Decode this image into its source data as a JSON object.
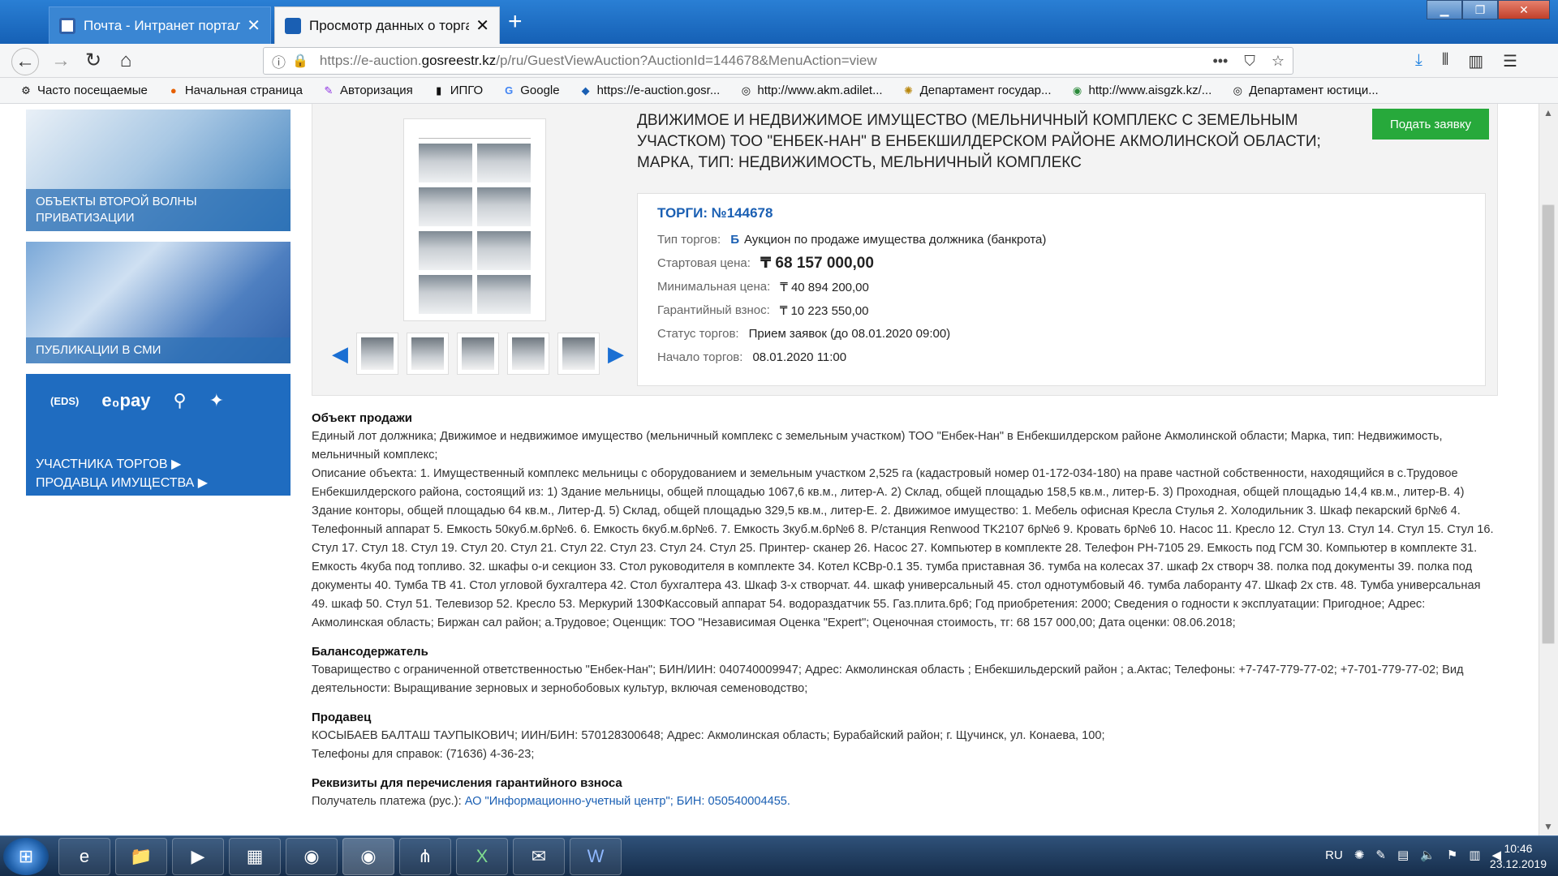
{
  "browser": {
    "tabs": [
      {
        "title": "Почта - Интранет портал гос",
        "close": "✕"
      },
      {
        "title": "Просмотр данных о торгах",
        "close": "✕"
      }
    ],
    "new_tab": "+",
    "window_buttons": {
      "minimize": "▁",
      "maximize": "❐",
      "close": "✕"
    },
    "url_prefix": "https://e-auction.",
    "url_domain": "gosreestr.kz",
    "url_suffix": "/p/ru/GuestViewAuction?AuctionId=144678&MenuAction=view",
    "bookmarks": [
      {
        "label": "Часто посещаемые",
        "icon": "⚙"
      },
      {
        "label": "Начальная страница",
        "icon": "●"
      },
      {
        "label": "Авторизация",
        "icon": "✎"
      },
      {
        "label": "ИПГО",
        "icon": "▮"
      },
      {
        "label": "Google",
        "icon": "G"
      },
      {
        "label": "https://e-auction.gosr...",
        "icon": "◆"
      },
      {
        "label": "http://www.akm.adilet...",
        "icon": "◎"
      },
      {
        "label": "Департамент государ...",
        "icon": "✺"
      },
      {
        "label": "http://www.aisgzk.kz/...",
        "icon": "◉"
      },
      {
        "label": "Департамент юстици...",
        "icon": "◎"
      }
    ]
  },
  "sidebar": {
    "card1": "Объекты второй волны приватизации",
    "card2": "Публикации в СМИ",
    "card3_icons": [
      "(EDS)",
      "e₀pay",
      "⚲",
      "✦"
    ],
    "card3_link1": "Участника торгов ▶",
    "card3_link2": "Продавца имущества ▶"
  },
  "lot": {
    "title": "Движимое и недвижимое имущество (мельничный комплекс с земельным участком) ТОО \"ЕНБЕК-НАН\" в Енбекшилдерском районе Акмолинской области; Марка, тип: Недвижимость, мельничный комплекс",
    "apply_button": "Подать заявку",
    "torgi": "ТОРГИ: №144678",
    "type_label": "Тип торгов:",
    "type_badge": "Б",
    "type_value": "Аукцион по продаже имущества должника (банкрота)",
    "start_price_label": "Стартовая цена:",
    "start_price": "₸ 68 157 000,00",
    "min_price_label": "Минимальная цена:",
    "min_price": "₸ 40 894 200,00",
    "guarantee_label": "Гарантийный взнос:",
    "guarantee": "₸ 10 223 550,00",
    "status_label": "Статус торгов:",
    "status": "Прием заявок (до 08.01.2020 09:00)",
    "start_label": "Начало торгов:",
    "start": "08.01.2020 11:00"
  },
  "description": {
    "sale_heading": "Объект продажи",
    "sale_text1": "Единый лот должника; Движимое и недвижимое имущество (мельничный комплекс с земельным участком) ТОО \"Енбек-Нан\" в Енбекшилдерском районе Акмолинской области; Марка, тип: Недвижимость, мельничный комплекс;",
    "sale_text2": "Описание объекта: 1. Имущественный комплекс мельницы с оборудованием и земельным участком 2,525 га (кадастровый номер 01-172-034-180) на праве частной собственности, находящийся в с.Трудовое Енбекшилдерского района, состоящий из: 1) Здание мельницы, общей площадью 1067,6 кв.м., литер-А. 2) Склад, общей площадью 158,5 кв.м., литер-Б. 3) Проходная, общей площадью 14,4 кв.м., литер-В. 4) Здание конторы, общей площадью 64 кв.м., Литер-Д. 5) Склад, общей площадью 329,5 кв.м., литер-Е. 2. Движимое имущество: 1. Мебель офисная Кресла Стулья 2. Холодильник 3. Шкаф пекарский 6р№6 4. Телефонный аппарат 5. Емкость 50куб.м.6р№6. 6. Емкость 6куб.м.6р№6. 7. Емкость 3куб.м.6р№6 8. Р/станция Renwood TK2107 6р№6 9. Кровать 6р№6 10. Насос 11. Кресло 12. Стул 13. Стул 14. Стул 15. Стул 16. Стул 17. Стул 18. Стул 19. Стул 20. Стул 21. Стул 22. Стул 23. Стул 24. Стул 25. Принтер- сканер 26. Насос 27. Компьютер в комплекте 28. Телефон PH-7105 29. Емкость под ГСМ 30. Компьютер в комплекте 31. Емкость 4куба под топливо. 32. шкафы о-и секцион 33. Стол руководителя в комплекте 34. Котел КСВр-0.1 35. тумба приставная 36. тумба на колесах 37. шкаф 2х створч 38. полка под документы 39. полка под документы 40. Тумба ТВ 41. Стол угловой бухгалтера 42. Стол бухгалтера 43. Шкаф 3-х створчат. 44. шкаф универсальный 45. стол однотумбовый 46. тумба лаборанту 47. Шкаф 2х ств. 48. Тумба универсальная 49. шкаф 50. Стул 51. Телевизор 52. Кресло 53. Меркурий 130ФКассовый аппарат 54. водораздатчик 55. Газ.плита.6р6; Год приобретения: 2000; Сведения о годности к эксплуатации: Пригодное; Адрес: Акмолинская область; Биржан сал район; а.Трудовое; Оценщик: ТОО \"Независимая Оценка \"Expert\"; Оценочная стоимость, тг: 68 157 000,00; Дата оценки: 08.06.2018;",
    "holder_heading": "Балансодержатель",
    "holder_text": "Товарищество с ограниченной ответственностью \"Енбек-Нан\"; БИН/ИИН: 040740009947; Адрес: Акмолинская область ; Енбекшильдерский район ; а.Актас; Телефоны: +7-747-779-77-02; +7-701-779-77-02; Вид деятельности: Выращивание зерновых и зернобобовых культур, включая семеноводство;",
    "seller_heading": "Продавец",
    "seller_text": "КОСЫБАЕВ БАЛТАШ ТАУПЫКОВИЧ; ИИН/БИН: 570128300648;  Адрес: Акмолинская область; Бурабайский район; г. Щучинск, ул. Конаева, 100;",
    "seller_phone": "Телефоны для справок: (71636) 4-36-23;",
    "requisites_heading": "Реквизиты для перечисления гарантийного взноса",
    "requisites_prefix": "Получатель платежа (рус.):",
    "requisites_link": "АО \"Информационно-учетный центр\"; БИН: 050540004455."
  },
  "taskbar": {
    "apps": [
      "e",
      "📁",
      "▶",
      "▦",
      "◉",
      "◉",
      "⋔",
      "X",
      "✉",
      "W"
    ],
    "lang": "RU",
    "time": "10:46",
    "date": "23.12.2019"
  },
  "colors": {
    "accent": "#1a5fb3",
    "apply": "#27a93b",
    "sidebar_blue": "#1f6cc0"
  }
}
